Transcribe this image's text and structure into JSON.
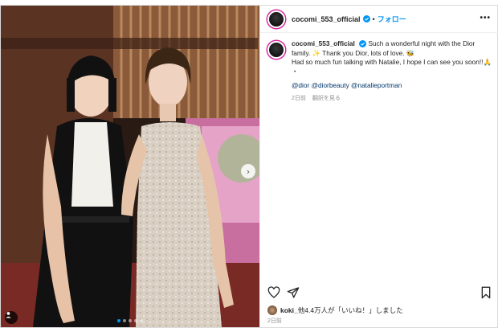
{
  "post": {
    "username": "cocomi_553_official",
    "follow_label": "フォロー",
    "more_label": "•••",
    "caption_line1": "Such a wonderful night with the Dior family. ✨ Thank you Dior, lots of love. 🐝",
    "caption_line2": "Had so much fun talking with Natalie, I hope I can see you soon!!🙏",
    "caption_bullet": "・",
    "hashtags": "@dior @diorbeauty @natalieportman",
    "caption_age": "2日前",
    "translate_label": "翻訳を見る",
    "likes_user": "koki_",
    "likes_text": "他4.4万人が「いいね！」しました",
    "post_age": "2日前"
  },
  "carousel": {
    "total": 5,
    "active": 0
  },
  "colors": {
    "link": "#00376b",
    "accent": "#0095f6",
    "muted": "#8e8e8e"
  },
  "icons": [
    "verified-badge-icon",
    "heart-icon",
    "share-icon",
    "bookmark-icon",
    "user-tag-icon",
    "chevron-right-icon"
  ]
}
